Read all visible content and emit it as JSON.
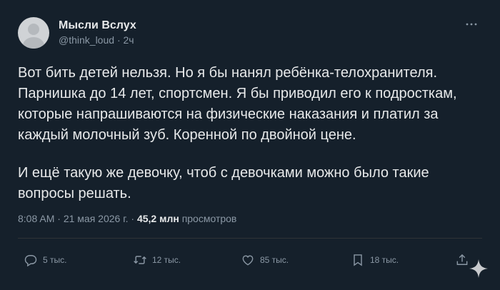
{
  "author": {
    "display_name": "Мысли Вслух",
    "handle": "@think_loud",
    "separator": "·",
    "time_ago": "2ч"
  },
  "tweet": {
    "paragraph_1": "Вот бить детей нельзя. Но я бы нанял ребёнка-телохранителя.\nПарнишка до 14 лет, спортсмен. Я бы приводил его к подросткам,\nкоторые напрашиваются на физические наказания и платил за\nкаждый молочный зуб. Коренной по двойной цене.",
    "paragraph_2": "И ещё такую же девочку, чтоб с девочками можно было такие\nвопросы решать."
  },
  "stamp": {
    "time": "8:08 AM",
    "date": "21 мая 2026 г.",
    "separator": "·",
    "views_count": "45,2 млн",
    "views_label": "просмотров"
  },
  "actions": {
    "reply_count": "5 тыс.",
    "retweet_count": "12 тыс.",
    "like_count": "85 тыс.",
    "bookmark_count": "18 тыс."
  },
  "icons": {
    "more": "more-dots-icon",
    "reply": "reply-icon",
    "retweet": "retweet-icon",
    "like": "heart-icon",
    "bookmark": "bookmark-icon",
    "share": "share-icon",
    "watermark": "sparkle-icon"
  },
  "colors": {
    "background": "#15202b",
    "text": "#e7e9ea",
    "secondary": "#8b98a5"
  }
}
